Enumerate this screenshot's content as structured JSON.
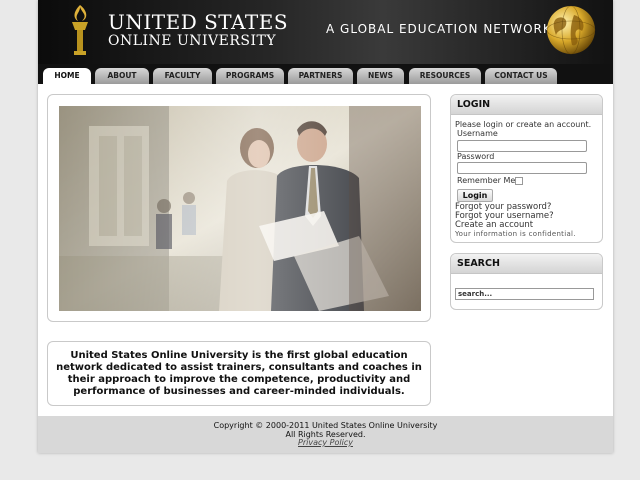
{
  "header": {
    "logo_line1": "UNITED STATES",
    "logo_line2": "ONLINE UNIVERSITY",
    "tagline": "A GLOBAL EDUCATION NETWORK",
    "torch_icon": "torch-icon",
    "globe_icon": "globe-icon"
  },
  "nav": {
    "items": [
      {
        "label": "HOME",
        "active": true
      },
      {
        "label": "ABOUT"
      },
      {
        "label": "FACULTY"
      },
      {
        "label": "PROGRAMS"
      },
      {
        "label": "PARTNERS"
      },
      {
        "label": "NEWS"
      },
      {
        "label": "RESOURCES"
      },
      {
        "label": "CONTACT US"
      }
    ]
  },
  "intro": {
    "text": "United States Online University is the first global education network dedicated to assist trainers, consultants and coaches in their approach to improve the competence, productivity and performance of businesses and career-minded individuals."
  },
  "login": {
    "title": "LOGIN",
    "prompt": "Please login or create an account.",
    "username_label": "Username",
    "password_label": "Password",
    "remember_label": "Remember Me",
    "button_label": "Login",
    "forgot_password": "Forgot your password?",
    "forgot_username": "Forgot your username?",
    "create_account": "Create an account",
    "confidential": "Your information is confidential."
  },
  "search": {
    "title": "SEARCH",
    "placeholder": "search..."
  },
  "footer": {
    "copyright": "Copyright © 2000-2011 United States Online University",
    "rights": "All Rights Reserved.",
    "privacy": "Privacy Policy"
  },
  "colors": {
    "header_bg": "#111111",
    "tab_bg": "#bdbdbd",
    "footer_bg": "#d8d8d8",
    "gold": "#c9a227"
  }
}
